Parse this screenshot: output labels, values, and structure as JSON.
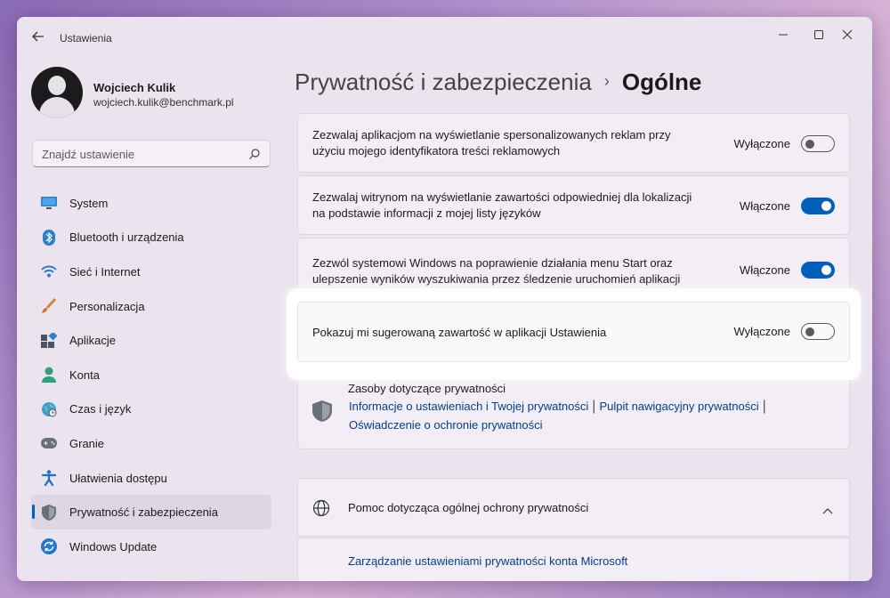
{
  "window": {
    "title": "Ustawienia",
    "back_icon": "arrow-left-icon",
    "controls": [
      "minimize-icon",
      "maximize-icon",
      "close-icon"
    ]
  },
  "profile": {
    "name": "Wojciech Kulik",
    "email": "wojciech.kulik@benchmark.pl"
  },
  "search": {
    "placeholder": "Znajdź ustawienie",
    "icon": "search-icon"
  },
  "sidebar": {
    "items": [
      {
        "label": "System",
        "icon": "monitor-icon"
      },
      {
        "label": "Bluetooth i urządzenia",
        "icon": "bluetooth-icon"
      },
      {
        "label": "Sieć i Internet",
        "icon": "wifi-icon"
      },
      {
        "label": "Personalizacja",
        "icon": "brush-icon"
      },
      {
        "label": "Aplikacje",
        "icon": "apps-icon"
      },
      {
        "label": "Konta",
        "icon": "person-icon"
      },
      {
        "label": "Czas i język",
        "icon": "globe-clock-icon"
      },
      {
        "label": "Granie",
        "icon": "gamepad-icon"
      },
      {
        "label": "Ułatwienia dostępu",
        "icon": "accessibility-icon"
      },
      {
        "label": "Prywatność i zabezpieczenia",
        "icon": "shield-icon",
        "active": true
      },
      {
        "label": "Windows Update",
        "icon": "update-icon"
      }
    ]
  },
  "header": {
    "parent": "Prywatność i zabezpieczenia",
    "separator": "›",
    "current": "Ogólne"
  },
  "settings": [
    {
      "text": "Zezwalaj aplikacjom na wyświetlanie spersonalizowanych reklam przy użyciu mojego identyfikatora treści reklamowych",
      "status": "Wyłączone",
      "on": false
    },
    {
      "text": "Zezwalaj witrynom na wyświetlanie zawartości odpowiedniej dla lokalizacji na podstawie informacji z mojej listy języków",
      "status": "Włączone",
      "on": true
    },
    {
      "text": "Zezwól systemowi Windows na poprawienie działania menu Start oraz ulepszenie wyników wyszukiwania przez śledzenie uruchomień aplikacji",
      "status": "Włączone",
      "on": true
    },
    {
      "text": "Pokazuj mi sugerowaną zawartość w aplikacji Ustawienia",
      "status": "Wyłączone",
      "on": false
    }
  ],
  "resources": {
    "title": "Zasoby dotyczące prywatności",
    "icon": "shield-icon",
    "links": [
      "Informacje o ustawieniach i Twojej prywatności",
      "Pulpit nawigacyjny prywatności",
      "Oświadczenie o ochronie prywatności"
    ],
    "separator": "|"
  },
  "help": {
    "title": "Pomoc dotycząca ogólnej ochrony prywatności",
    "icon": "globe-icon",
    "expand_icon": "chevron-up-icon",
    "link": "Zarządzanie ustawieniami prywatności konta Microsoft"
  },
  "colors": {
    "accent": "#005fb8",
    "link": "#003e92"
  }
}
